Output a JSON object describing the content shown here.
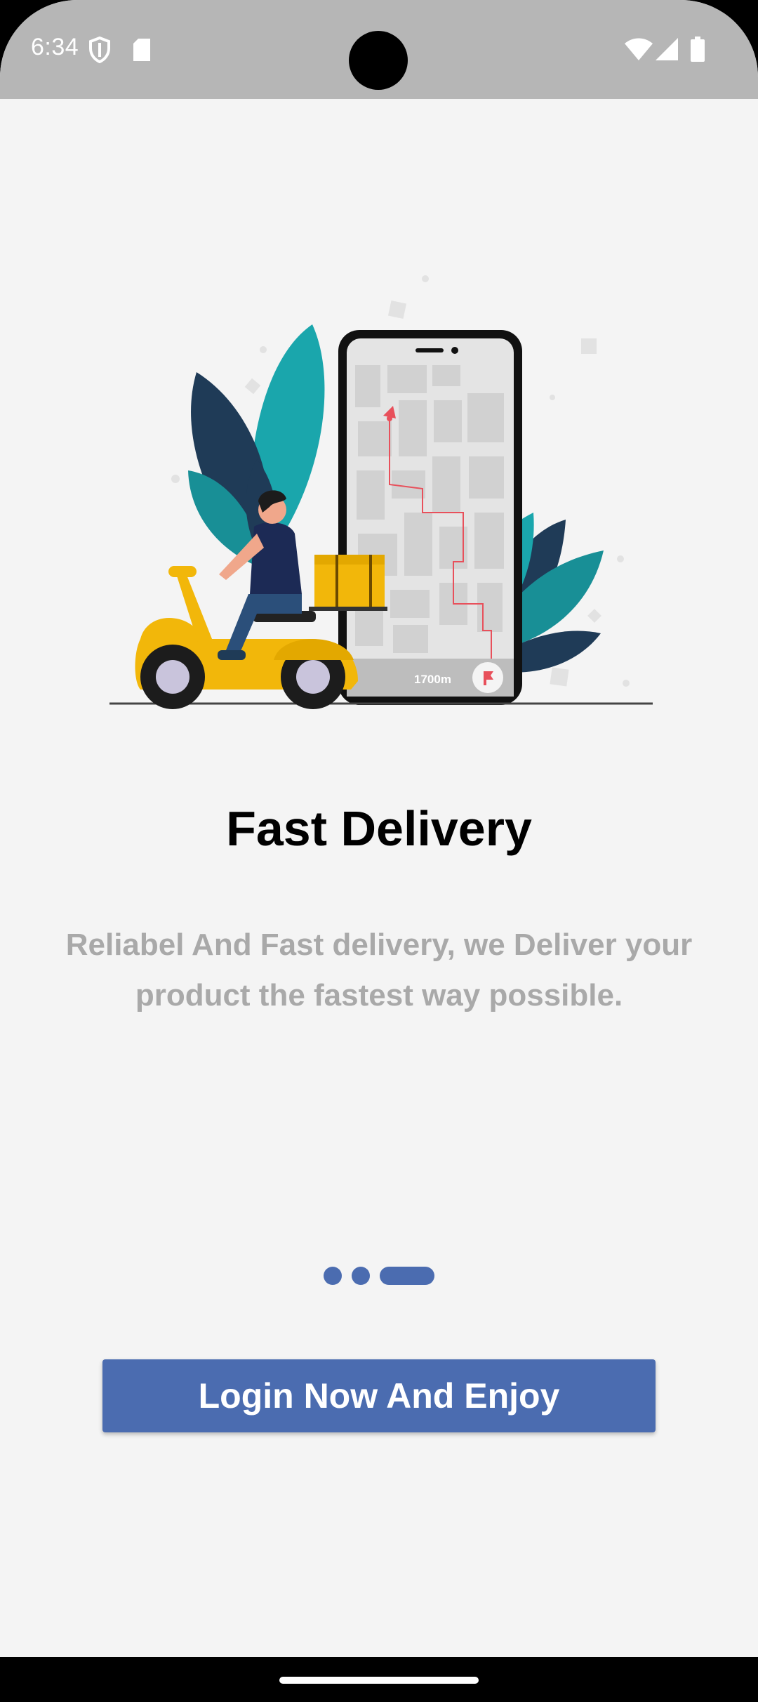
{
  "status_bar": {
    "time": "6:34",
    "icons_left": [
      "shield-icon",
      "sd-card-icon"
    ],
    "icons_right": [
      "wifi-icon",
      "cellular-signal-icon",
      "battery-icon"
    ]
  },
  "illustration": {
    "distance_label": "1700m"
  },
  "onboarding": {
    "title": "Fast Delivery",
    "description": "Reliabel And Fast delivery, we Deliver your product the fastest way possible.",
    "page_indicator": {
      "total": 3,
      "active_index": 2
    }
  },
  "actions": {
    "login_label": "Login Now And Enjoy"
  },
  "colors": {
    "primary": "#4b6cb0",
    "background": "#f4f4f4",
    "status_bar": "#b6b6b6",
    "description_text": "#a9a9a9",
    "scooter_yellow": "#f2b70a",
    "leaf_teal": "#1aa6ac",
    "leaf_navy": "#1f3b57",
    "route_red": "#e8505b"
  }
}
